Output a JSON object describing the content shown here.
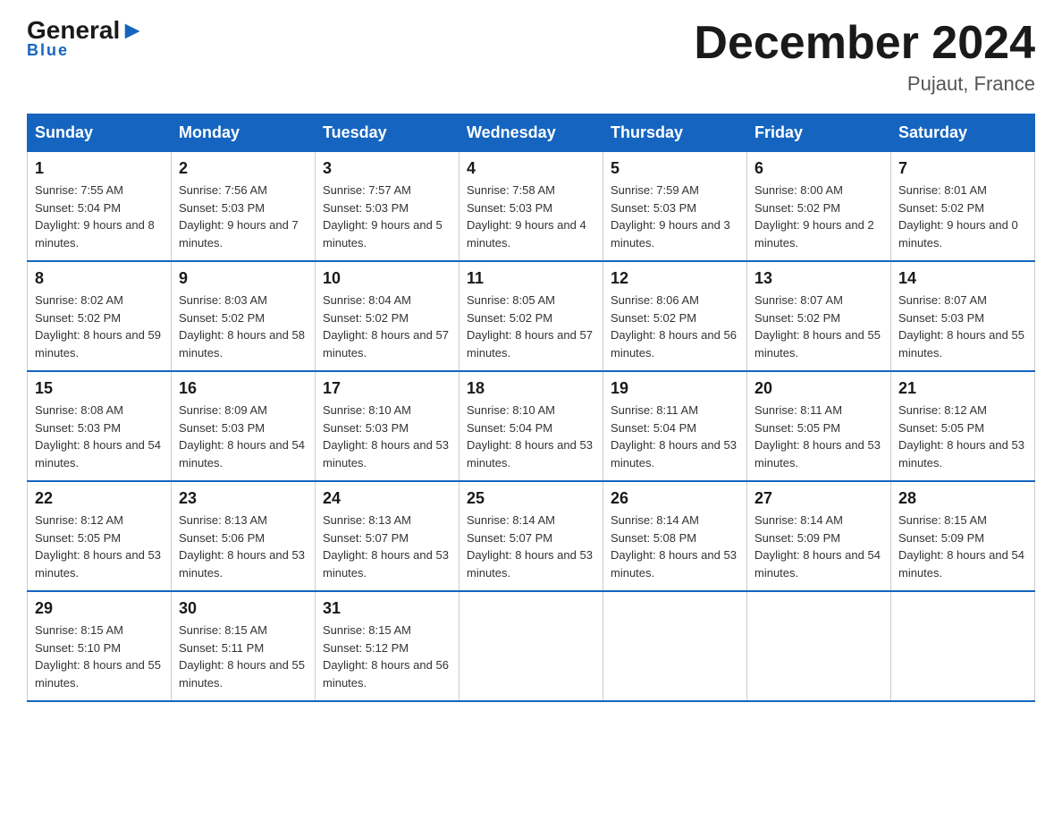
{
  "logo": {
    "general": "General",
    "arrow": "▶",
    "blue": "Blue"
  },
  "header": {
    "title": "December 2024",
    "location": "Pujaut, France"
  },
  "days_of_week": [
    "Sunday",
    "Monday",
    "Tuesday",
    "Wednesday",
    "Thursday",
    "Friday",
    "Saturday"
  ],
  "weeks": [
    [
      {
        "day": "1",
        "sunrise": "7:55 AM",
        "sunset": "5:04 PM",
        "daylight": "9 hours and 8 minutes."
      },
      {
        "day": "2",
        "sunrise": "7:56 AM",
        "sunset": "5:03 PM",
        "daylight": "9 hours and 7 minutes."
      },
      {
        "day": "3",
        "sunrise": "7:57 AM",
        "sunset": "5:03 PM",
        "daylight": "9 hours and 5 minutes."
      },
      {
        "day": "4",
        "sunrise": "7:58 AM",
        "sunset": "5:03 PM",
        "daylight": "9 hours and 4 minutes."
      },
      {
        "day": "5",
        "sunrise": "7:59 AM",
        "sunset": "5:03 PM",
        "daylight": "9 hours and 3 minutes."
      },
      {
        "day": "6",
        "sunrise": "8:00 AM",
        "sunset": "5:02 PM",
        "daylight": "9 hours and 2 minutes."
      },
      {
        "day": "7",
        "sunrise": "8:01 AM",
        "sunset": "5:02 PM",
        "daylight": "9 hours and 0 minutes."
      }
    ],
    [
      {
        "day": "8",
        "sunrise": "8:02 AM",
        "sunset": "5:02 PM",
        "daylight": "8 hours and 59 minutes."
      },
      {
        "day": "9",
        "sunrise": "8:03 AM",
        "sunset": "5:02 PM",
        "daylight": "8 hours and 58 minutes."
      },
      {
        "day": "10",
        "sunrise": "8:04 AM",
        "sunset": "5:02 PM",
        "daylight": "8 hours and 57 minutes."
      },
      {
        "day": "11",
        "sunrise": "8:05 AM",
        "sunset": "5:02 PM",
        "daylight": "8 hours and 57 minutes."
      },
      {
        "day": "12",
        "sunrise": "8:06 AM",
        "sunset": "5:02 PM",
        "daylight": "8 hours and 56 minutes."
      },
      {
        "day": "13",
        "sunrise": "8:07 AM",
        "sunset": "5:02 PM",
        "daylight": "8 hours and 55 minutes."
      },
      {
        "day": "14",
        "sunrise": "8:07 AM",
        "sunset": "5:03 PM",
        "daylight": "8 hours and 55 minutes."
      }
    ],
    [
      {
        "day": "15",
        "sunrise": "8:08 AM",
        "sunset": "5:03 PM",
        "daylight": "8 hours and 54 minutes."
      },
      {
        "day": "16",
        "sunrise": "8:09 AM",
        "sunset": "5:03 PM",
        "daylight": "8 hours and 54 minutes."
      },
      {
        "day": "17",
        "sunrise": "8:10 AM",
        "sunset": "5:03 PM",
        "daylight": "8 hours and 53 minutes."
      },
      {
        "day": "18",
        "sunrise": "8:10 AM",
        "sunset": "5:04 PM",
        "daylight": "8 hours and 53 minutes."
      },
      {
        "day": "19",
        "sunrise": "8:11 AM",
        "sunset": "5:04 PM",
        "daylight": "8 hours and 53 minutes."
      },
      {
        "day": "20",
        "sunrise": "8:11 AM",
        "sunset": "5:05 PM",
        "daylight": "8 hours and 53 minutes."
      },
      {
        "day": "21",
        "sunrise": "8:12 AM",
        "sunset": "5:05 PM",
        "daylight": "8 hours and 53 minutes."
      }
    ],
    [
      {
        "day": "22",
        "sunrise": "8:12 AM",
        "sunset": "5:05 PM",
        "daylight": "8 hours and 53 minutes."
      },
      {
        "day": "23",
        "sunrise": "8:13 AM",
        "sunset": "5:06 PM",
        "daylight": "8 hours and 53 minutes."
      },
      {
        "day": "24",
        "sunrise": "8:13 AM",
        "sunset": "5:07 PM",
        "daylight": "8 hours and 53 minutes."
      },
      {
        "day": "25",
        "sunrise": "8:14 AM",
        "sunset": "5:07 PM",
        "daylight": "8 hours and 53 minutes."
      },
      {
        "day": "26",
        "sunrise": "8:14 AM",
        "sunset": "5:08 PM",
        "daylight": "8 hours and 53 minutes."
      },
      {
        "day": "27",
        "sunrise": "8:14 AM",
        "sunset": "5:09 PM",
        "daylight": "8 hours and 54 minutes."
      },
      {
        "day": "28",
        "sunrise": "8:15 AM",
        "sunset": "5:09 PM",
        "daylight": "8 hours and 54 minutes."
      }
    ],
    [
      {
        "day": "29",
        "sunrise": "8:15 AM",
        "sunset": "5:10 PM",
        "daylight": "8 hours and 55 minutes."
      },
      {
        "day": "30",
        "sunrise": "8:15 AM",
        "sunset": "5:11 PM",
        "daylight": "8 hours and 55 minutes."
      },
      {
        "day": "31",
        "sunrise": "8:15 AM",
        "sunset": "5:12 PM",
        "daylight": "8 hours and 56 minutes."
      },
      null,
      null,
      null,
      null
    ]
  ]
}
